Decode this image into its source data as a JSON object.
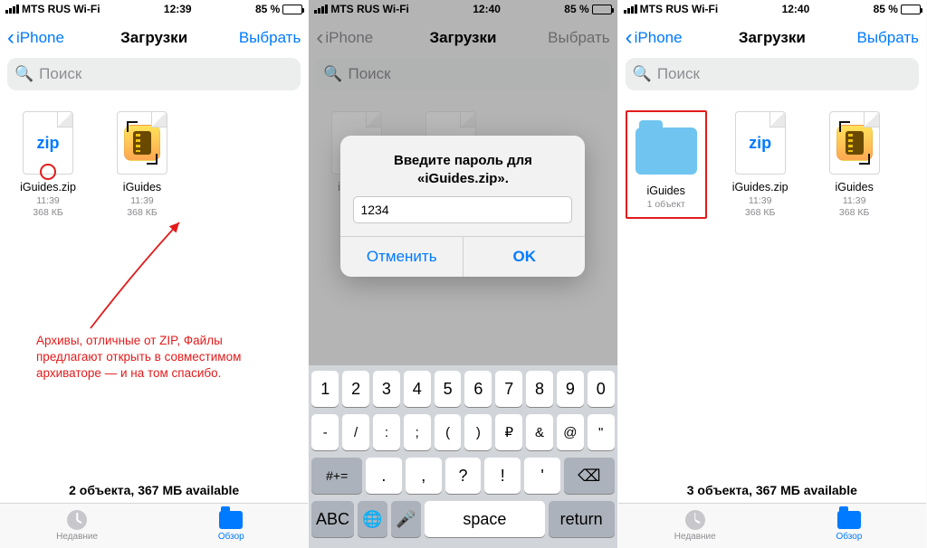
{
  "status": {
    "carrier": "MTS RUS Wi-Fi",
    "time1": "12:39",
    "time2": "12:40",
    "battery": "85 %"
  },
  "nav": {
    "back": "iPhone",
    "title": "Загрузки",
    "select": "Выбрать"
  },
  "search": {
    "placeholder": "Поиск"
  },
  "files": {
    "zip": {
      "name": "iGuides.zip",
      "time": "11:39",
      "size": "368 КБ"
    },
    "rar": {
      "name": "iGuides",
      "time": "11:39",
      "size": "368 КБ"
    },
    "folder": {
      "name": "iGuides",
      "meta": "1 объект"
    }
  },
  "annotation": "Архивы, отличные от ZIP, Файлы предлагают открыть в совместимом архиваторе — и на том спасибо.",
  "summary": {
    "left": "2 объекта, 367 МБ available",
    "right": "3 объекта, 367 МБ available"
  },
  "tabs": {
    "recent": "Недавние",
    "browse": "Обзор"
  },
  "modal": {
    "message": "Введите пароль для «iGuides.zip».",
    "value": "1234",
    "cancel": "Отменить",
    "ok": "OK"
  },
  "keyboard": {
    "row1": [
      "1",
      "2",
      "3",
      "4",
      "5",
      "6",
      "7",
      "8",
      "9",
      "0"
    ],
    "row2": [
      "-",
      "/",
      ":",
      ";",
      "(",
      ")",
      "₽",
      "&",
      "@",
      "\""
    ],
    "row3_shift": "#+=",
    "row3": [
      ".",
      ",",
      "?",
      "!",
      "'"
    ],
    "row3_del": "⌫",
    "row4": {
      "abc": "ABC",
      "globe": "🌐",
      "mic": "🎤",
      "space": "space",
      "return": "return"
    }
  }
}
